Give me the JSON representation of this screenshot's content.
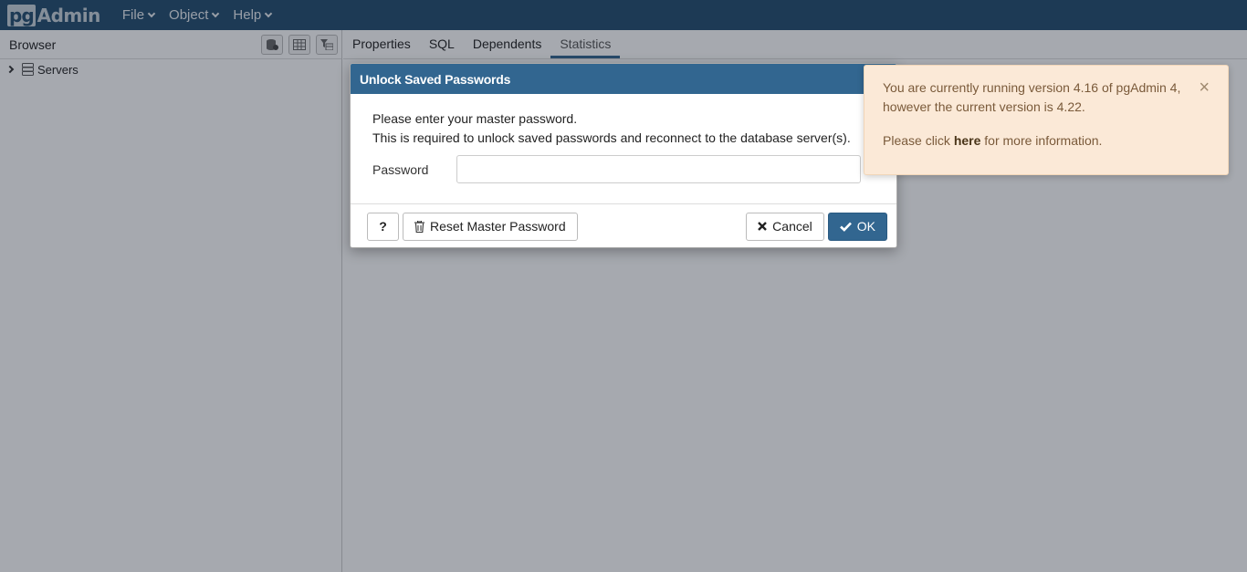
{
  "navbar": {
    "logo_pg": "pg",
    "logo_admin": "Admin",
    "menu": [
      {
        "label": "File"
      },
      {
        "label": "Object"
      },
      {
        "label": "Help"
      }
    ]
  },
  "browser": {
    "title": "Browser",
    "tree": [
      {
        "label": "Servers"
      }
    ]
  },
  "main": {
    "tabs": [
      {
        "label": "Properties"
      },
      {
        "label": "SQL"
      },
      {
        "label": "Dependents"
      },
      {
        "label": "Statistics",
        "active": true
      }
    ]
  },
  "dialog": {
    "title": "Unlock Saved Passwords",
    "message_line1": "Please enter your master password.",
    "message_line2": "This is required to unlock saved passwords and reconnect to the database server(s).",
    "password_label": "Password",
    "password_value": "",
    "help_label": "?",
    "reset_label": "Reset Master Password",
    "cancel_label": "Cancel",
    "ok_label": "OK"
  },
  "notification": {
    "text1": "You are currently running version 4.16 of pgAdmin 4, however the current version is 4.22.",
    "text2_before": "Please click ",
    "text2_link": "here",
    "text2_after": " for more information.",
    "close_label": "×"
  },
  "colors": {
    "navbar": "#234d6f",
    "dialog_header": "#326690",
    "notification_bg": "#fbe9d7"
  }
}
